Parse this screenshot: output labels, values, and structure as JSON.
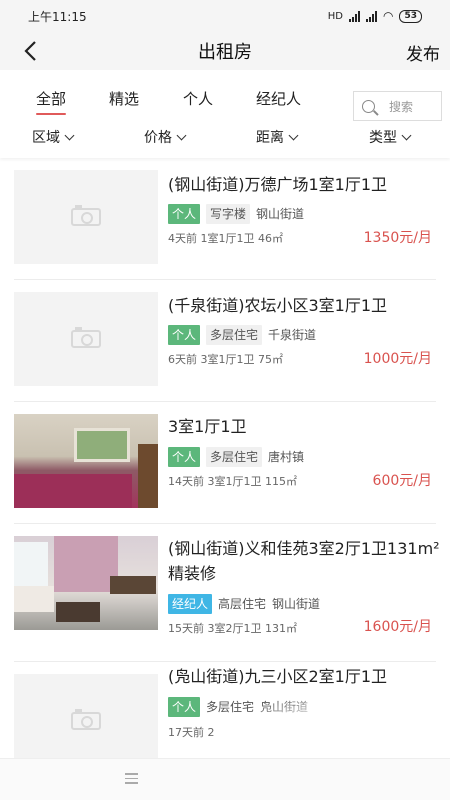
{
  "status_bar": {
    "time": "上午11:15",
    "network": "HD",
    "battery": "53"
  },
  "nav": {
    "title": "出租房",
    "publish_label": "发布"
  },
  "tabs": [
    {
      "label": "全部",
      "active": true
    },
    {
      "label": "精选",
      "active": false
    },
    {
      "label": "个人",
      "active": false
    },
    {
      "label": "经纪人",
      "active": false
    }
  ],
  "search": {
    "placeholder": "搜索"
  },
  "filters": [
    {
      "label": "区域"
    },
    {
      "label": "价格"
    },
    {
      "label": "距离"
    },
    {
      "label": "类型"
    }
  ],
  "listings": [
    {
      "title": "(钢山街道)万德广场1室1厅1卫",
      "source_tag": "个人",
      "type_tag": "写字楼",
      "area": "钢山街道",
      "meta": "4天前 1室1厅1卫 46㎡",
      "price": "1350元/月",
      "image": "placeholder"
    },
    {
      "title": "(千泉街道)农坛小区3室1厅1卫",
      "source_tag": "个人",
      "type_tag": "多层住宅",
      "area": "千泉街道",
      "meta": "6天前 3室1厅1卫 75㎡",
      "price": "1000元/月",
      "image": "placeholder"
    },
    {
      "title": "3室1厅1卫",
      "source_tag": "个人",
      "type_tag": "多层住宅",
      "area": "唐村镇",
      "meta": "14天前 3室1厅1卫 115㎡",
      "price": "600元/月",
      "image": "bedroom-photo"
    },
    {
      "title": "(钢山街道)义和佳苑3室2厅1卫131m²精装修",
      "source_tag": "经纪人",
      "type_tag": "高层住宅",
      "area": "钢山街道",
      "meta": "15天前 3室2厅1卫 131㎡",
      "price": "1600元/月",
      "image": "living-room-photo"
    },
    {
      "title": "(凫山街道)九三小区2室1厅1卫",
      "source_tag": "个人",
      "type_tag": "多层住宅",
      "area": "凫山街道",
      "meta": "17天前 2",
      "price": "",
      "image": "placeholder"
    }
  ],
  "colors": {
    "accent": "#e05a5a",
    "price": "#d9534f",
    "personal_tag": "#5cb77b",
    "agent_tag": "#3fb6e5"
  }
}
